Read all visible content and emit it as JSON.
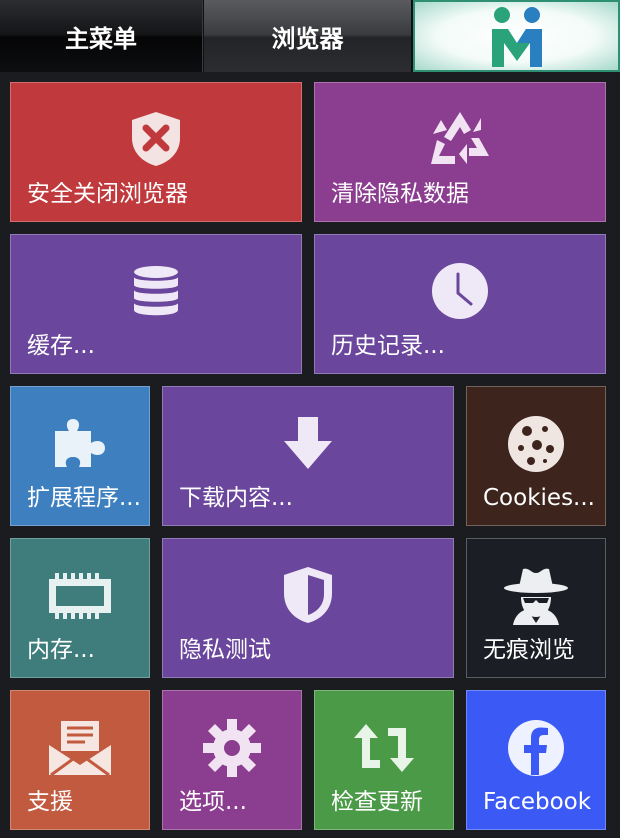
{
  "tabs": {
    "main": "主菜单",
    "browser": "浏览器",
    "logo_icon": "people-logo-icon"
  },
  "tiles": {
    "safe_close": {
      "label": "安全关闭浏览器",
      "color": "#c0393c",
      "icon": "shield-x-icon"
    },
    "clear_private": {
      "label": "清除隐私数据",
      "color": "#8b3d8f",
      "icon": "recycle-icon"
    },
    "cache": {
      "label": "缓存...",
      "color": "#6a479c",
      "icon": "database-icon"
    },
    "history": {
      "label": "历史记录...",
      "color": "#6a479c",
      "icon": "clock-icon"
    },
    "extensions": {
      "label": "扩展程序...",
      "color": "#3d7fbf",
      "icon": "puzzle-icon"
    },
    "downloads": {
      "label": "下载内容...",
      "color": "#6a479c",
      "icon": "download-arrow-icon"
    },
    "cookies": {
      "label": "Cookies...",
      "color": "#3d241c",
      "icon": "cookie-icon"
    },
    "memory": {
      "label": "内存...",
      "color": "#3e7d7c",
      "icon": "memory-chip-icon"
    },
    "privacy_test": {
      "label": "隐私测试",
      "color": "#6a479c",
      "icon": "shield-icon"
    },
    "incognito": {
      "label": "无痕浏览",
      "color": "#1b1e24",
      "icon": "spy-icon"
    },
    "support": {
      "label": "支援",
      "color": "#c15a3f",
      "icon": "mail-icon"
    },
    "options": {
      "label": "选项...",
      "color": "#8b3d8f",
      "icon": "gear-icon"
    },
    "update": {
      "label": "检查更新",
      "color": "#4b9a48",
      "icon": "refresh-icon"
    },
    "facebook": {
      "label": "Facebook",
      "color": "#3b5af5",
      "icon": "facebook-icon"
    }
  }
}
